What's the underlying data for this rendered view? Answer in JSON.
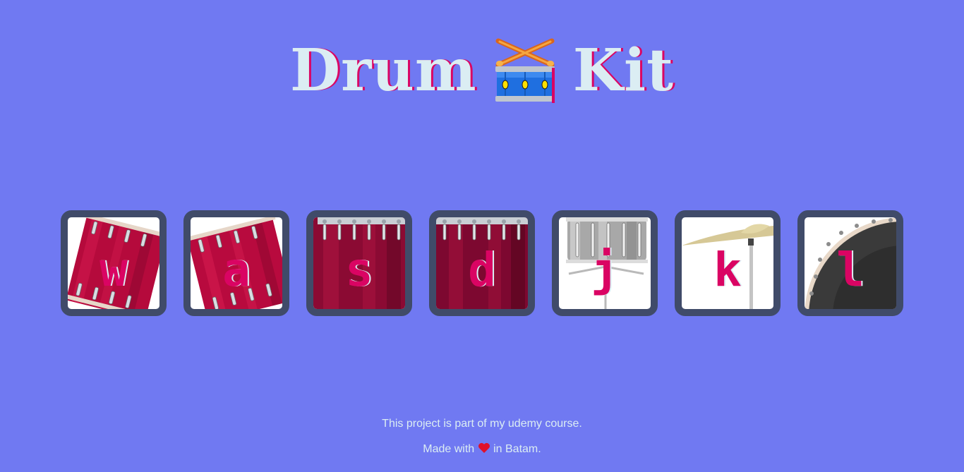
{
  "header": {
    "title_left": "Drum",
    "title_icon": "drum-with-drumsticks-icon",
    "title_right": "Kit"
  },
  "drums": [
    {
      "key": "w",
      "art": "tom-1"
    },
    {
      "key": "a",
      "art": "tom-2"
    },
    {
      "key": "s",
      "art": "tom-3"
    },
    {
      "key": "d",
      "art": "tom-4"
    },
    {
      "key": "j",
      "art": "snare"
    },
    {
      "key": "k",
      "art": "crash-cymbal"
    },
    {
      "key": "l",
      "art": "kick-bass"
    }
  ],
  "footer": {
    "course_note": "This project is part of my udemy course.",
    "made_with": "Made with",
    "heart_icon": "heart-icon",
    "location": "in Batam."
  },
  "colors": {
    "background": "#7079f2",
    "title": "#dbedf3",
    "accent": "#da0463",
    "button_border": "#404b69"
  }
}
